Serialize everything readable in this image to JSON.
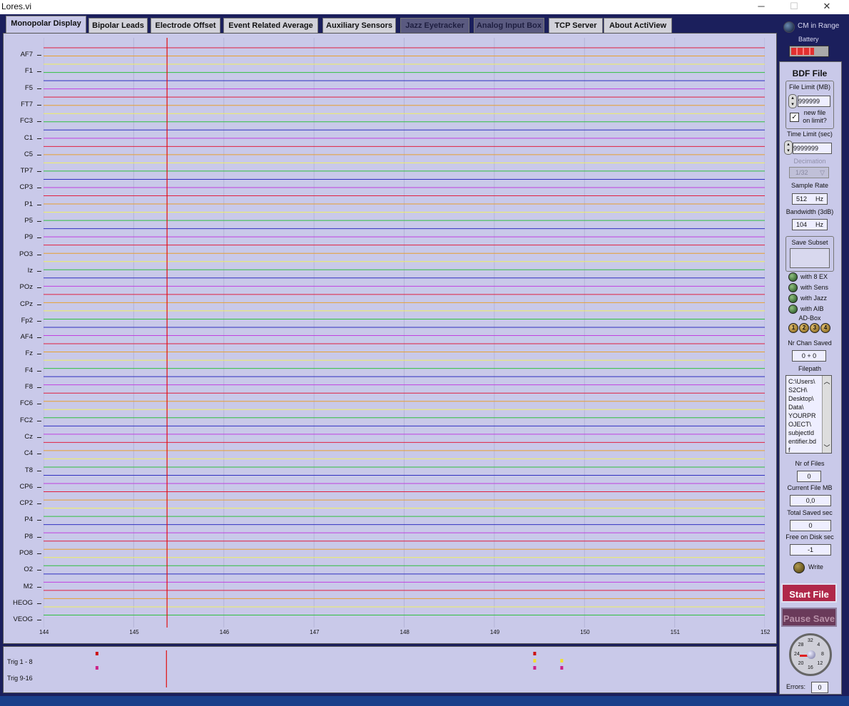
{
  "window": {
    "title": "Lores.vi",
    "minimize": "─",
    "maximize": "☐",
    "close": "✕"
  },
  "tabs": [
    {
      "label": "Monopolar Display",
      "active": true
    },
    {
      "label": "Bipolar Leads"
    },
    {
      "label": "Electrode Offset"
    },
    {
      "label": "Event Related Average"
    },
    {
      "label": "Auxiliary Sensors"
    },
    {
      "label": "Jazz Eyetracker",
      "dim": true
    },
    {
      "label": "Analog Input Box",
      "dim": true
    },
    {
      "label": "TCP Server"
    },
    {
      "label": "About ActiView"
    }
  ],
  "channels": [
    "AF7",
    "F1",
    "F5",
    "FT7",
    "FC3",
    "C1",
    "C5",
    "TP7",
    "CP3",
    "P1",
    "P5",
    "P9",
    "PO3",
    "Iz",
    "POz",
    "CPz",
    "Fp2",
    "AF4",
    "Fz",
    "F4",
    "F8",
    "FC6",
    "FC2",
    "Cz",
    "C4",
    "T8",
    "CP6",
    "CP2",
    "P4",
    "P8",
    "PO8",
    "O2",
    "M2",
    "HEOG",
    "VEOG"
  ],
  "trace_colors": [
    "#e02040",
    "#e8a030",
    "#f0f060",
    "#30c040",
    "#3030c0",
    "#c040e0"
  ],
  "x_axis": {
    "ticks": [
      "144",
      "145",
      "146",
      "147",
      "148",
      "149",
      "150",
      "151",
      "152"
    ],
    "min": 144,
    "max": 152
  },
  "cursor_time": 145.37,
  "triggers": {
    "labels": [
      "Trig 1 - 8",
      "Trig 9-16"
    ],
    "marks": [
      {
        "t": 144.6,
        "row": 0,
        "color": "#cc1010"
      },
      {
        "t": 144.6,
        "row": 1,
        "color": "#cc2288"
      },
      {
        "t": 149.45,
        "row": 0,
        "color": "#cc1010"
      },
      {
        "t": 149.45,
        "row": 0.5,
        "color": "#f0e030"
      },
      {
        "t": 149.45,
        "row": 1,
        "color": "#cc2288"
      },
      {
        "t": 149.75,
        "row": 0.5,
        "color": "#f0e030"
      },
      {
        "t": 149.75,
        "row": 1,
        "color": "#cc2288"
      }
    ]
  },
  "sidebar": {
    "cm_in_range": "CM in Range",
    "battery": "Battery",
    "bdf_file": "BDF File",
    "file_limit_label": "File Limit (MB)",
    "file_limit_value": "999999",
    "new_file_label": "new file on limit?",
    "time_limit_label": "Time Limit (sec)",
    "time_limit_value": "9999999",
    "decimation_label": "Decimation",
    "decimation_value": "1/32",
    "sample_rate_label": "Sample Rate",
    "sample_rate_value": "512",
    "sample_rate_unit": "Hz",
    "bandwidth_label": "Bandwidth (3dB)",
    "bandwidth_value": "104",
    "bandwidth_unit": "Hz",
    "save_subset_label": "Save Subset",
    "with_options": [
      "with 8 EX",
      "with Sens",
      "with Jazz",
      "with AIB"
    ],
    "ad_box_label": "AD-Box",
    "ad_box_buttons": [
      "1",
      "2",
      "3",
      "4"
    ],
    "nr_chan_saved_label": "Nr Chan Saved",
    "nr_chan_saved_value": "0 + 0",
    "filepath_label": "Filepath",
    "filepath_value": "C:\\Users\\S2CH\\Desktop\\Data\\YOURPROJECT\\subjectIdentifier.bdf",
    "filepath_lines": [
      "C:\\Users\\",
      "S2CH\\",
      "Desktop\\",
      "Data\\",
      "YOURPR",
      "OJECT\\",
      "subjectId",
      "entifier.bd",
      "f"
    ],
    "nr_files_label": "Nr of Files",
    "nr_files_value": "0",
    "current_file_label": "Current File MB",
    "current_file_value": "0,0",
    "total_saved_label": "Total Saved sec",
    "total_saved_value": "0",
    "free_disk_label": "Free on Disk sec",
    "free_disk_value": "-1",
    "write_label": "Write",
    "start_file": "Start File",
    "pause_save": "Pause Save",
    "errors_label": "Errors:",
    "errors_value": "0",
    "dial_labels": [
      "32",
      "4",
      "8",
      "12",
      "16",
      "20",
      "24",
      "28"
    ]
  }
}
